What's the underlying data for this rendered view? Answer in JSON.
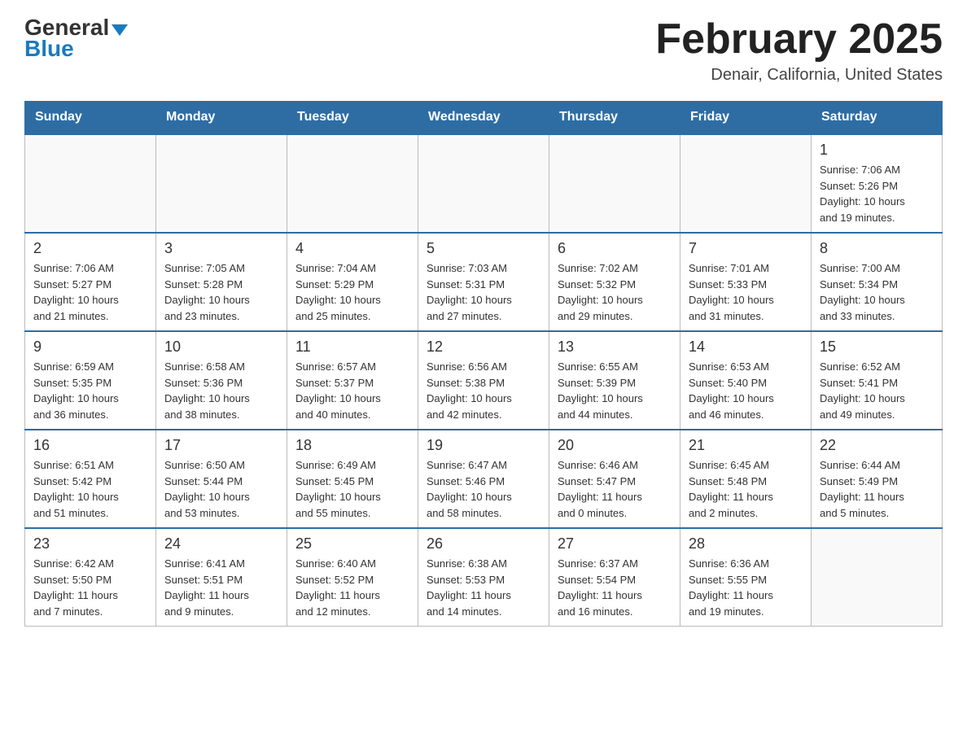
{
  "logo": {
    "line1": "General",
    "arrow": true,
    "line2": "Blue"
  },
  "title": {
    "month_year": "February 2025",
    "location": "Denair, California, United States"
  },
  "weekdays": [
    "Sunday",
    "Monday",
    "Tuesday",
    "Wednesday",
    "Thursday",
    "Friday",
    "Saturday"
  ],
  "weeks": [
    [
      {
        "day": "",
        "info": ""
      },
      {
        "day": "",
        "info": ""
      },
      {
        "day": "",
        "info": ""
      },
      {
        "day": "",
        "info": ""
      },
      {
        "day": "",
        "info": ""
      },
      {
        "day": "",
        "info": ""
      },
      {
        "day": "1",
        "info": "Sunrise: 7:06 AM\nSunset: 5:26 PM\nDaylight: 10 hours\nand 19 minutes."
      }
    ],
    [
      {
        "day": "2",
        "info": "Sunrise: 7:06 AM\nSunset: 5:27 PM\nDaylight: 10 hours\nand 21 minutes."
      },
      {
        "day": "3",
        "info": "Sunrise: 7:05 AM\nSunset: 5:28 PM\nDaylight: 10 hours\nand 23 minutes."
      },
      {
        "day": "4",
        "info": "Sunrise: 7:04 AM\nSunset: 5:29 PM\nDaylight: 10 hours\nand 25 minutes."
      },
      {
        "day": "5",
        "info": "Sunrise: 7:03 AM\nSunset: 5:31 PM\nDaylight: 10 hours\nand 27 minutes."
      },
      {
        "day": "6",
        "info": "Sunrise: 7:02 AM\nSunset: 5:32 PM\nDaylight: 10 hours\nand 29 minutes."
      },
      {
        "day": "7",
        "info": "Sunrise: 7:01 AM\nSunset: 5:33 PM\nDaylight: 10 hours\nand 31 minutes."
      },
      {
        "day": "8",
        "info": "Sunrise: 7:00 AM\nSunset: 5:34 PM\nDaylight: 10 hours\nand 33 minutes."
      }
    ],
    [
      {
        "day": "9",
        "info": "Sunrise: 6:59 AM\nSunset: 5:35 PM\nDaylight: 10 hours\nand 36 minutes."
      },
      {
        "day": "10",
        "info": "Sunrise: 6:58 AM\nSunset: 5:36 PM\nDaylight: 10 hours\nand 38 minutes."
      },
      {
        "day": "11",
        "info": "Sunrise: 6:57 AM\nSunset: 5:37 PM\nDaylight: 10 hours\nand 40 minutes."
      },
      {
        "day": "12",
        "info": "Sunrise: 6:56 AM\nSunset: 5:38 PM\nDaylight: 10 hours\nand 42 minutes."
      },
      {
        "day": "13",
        "info": "Sunrise: 6:55 AM\nSunset: 5:39 PM\nDaylight: 10 hours\nand 44 minutes."
      },
      {
        "day": "14",
        "info": "Sunrise: 6:53 AM\nSunset: 5:40 PM\nDaylight: 10 hours\nand 46 minutes."
      },
      {
        "day": "15",
        "info": "Sunrise: 6:52 AM\nSunset: 5:41 PM\nDaylight: 10 hours\nand 49 minutes."
      }
    ],
    [
      {
        "day": "16",
        "info": "Sunrise: 6:51 AM\nSunset: 5:42 PM\nDaylight: 10 hours\nand 51 minutes."
      },
      {
        "day": "17",
        "info": "Sunrise: 6:50 AM\nSunset: 5:44 PM\nDaylight: 10 hours\nand 53 minutes."
      },
      {
        "day": "18",
        "info": "Sunrise: 6:49 AM\nSunset: 5:45 PM\nDaylight: 10 hours\nand 55 minutes."
      },
      {
        "day": "19",
        "info": "Sunrise: 6:47 AM\nSunset: 5:46 PM\nDaylight: 10 hours\nand 58 minutes."
      },
      {
        "day": "20",
        "info": "Sunrise: 6:46 AM\nSunset: 5:47 PM\nDaylight: 11 hours\nand 0 minutes."
      },
      {
        "day": "21",
        "info": "Sunrise: 6:45 AM\nSunset: 5:48 PM\nDaylight: 11 hours\nand 2 minutes."
      },
      {
        "day": "22",
        "info": "Sunrise: 6:44 AM\nSunset: 5:49 PM\nDaylight: 11 hours\nand 5 minutes."
      }
    ],
    [
      {
        "day": "23",
        "info": "Sunrise: 6:42 AM\nSunset: 5:50 PM\nDaylight: 11 hours\nand 7 minutes."
      },
      {
        "day": "24",
        "info": "Sunrise: 6:41 AM\nSunset: 5:51 PM\nDaylight: 11 hours\nand 9 minutes."
      },
      {
        "day": "25",
        "info": "Sunrise: 6:40 AM\nSunset: 5:52 PM\nDaylight: 11 hours\nand 12 minutes."
      },
      {
        "day": "26",
        "info": "Sunrise: 6:38 AM\nSunset: 5:53 PM\nDaylight: 11 hours\nand 14 minutes."
      },
      {
        "day": "27",
        "info": "Sunrise: 6:37 AM\nSunset: 5:54 PM\nDaylight: 11 hours\nand 16 minutes."
      },
      {
        "day": "28",
        "info": "Sunrise: 6:36 AM\nSunset: 5:55 PM\nDaylight: 11 hours\nand 19 minutes."
      },
      {
        "day": "",
        "info": ""
      }
    ]
  ]
}
